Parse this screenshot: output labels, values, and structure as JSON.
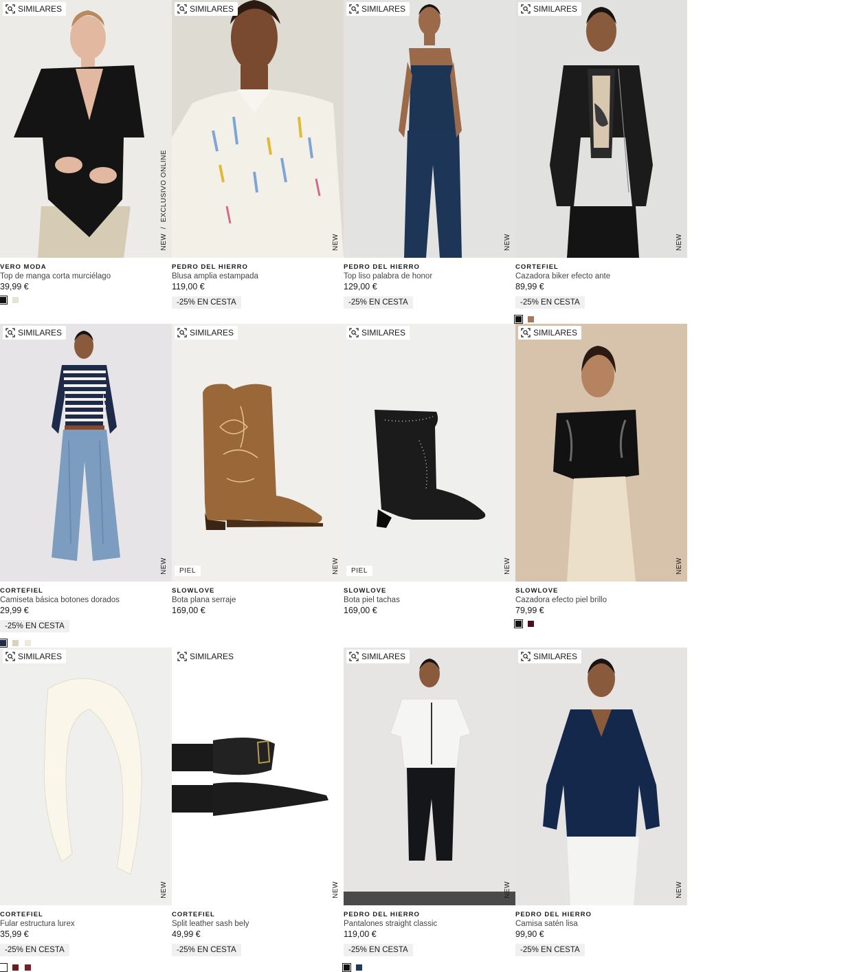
{
  "ui": {
    "similar_label": "SIMILARES",
    "new_label": "NEW",
    "exclusive_label": "EXCLUSIVO ONLINE",
    "promo_label": "-25% EN CESTA"
  },
  "products": [
    {
      "brand": "VERO MODA",
      "name": "Top de manga corta murciélago",
      "price": "39,99 €",
      "promo": "",
      "exclusive": "EXCLUSIVO ONLINE",
      "material": "",
      "swatches": [
        "#111111",
        "#e8e2d5"
      ]
    },
    {
      "brand": "PEDRO DEL HIERRO",
      "name": "Blusa amplia estampada",
      "price": "119,00 €",
      "promo": "-25% EN CESTA",
      "exclusive": "",
      "material": "",
      "swatches": []
    },
    {
      "brand": "PEDRO DEL HIERRO",
      "name": "Top liso palabra de honor",
      "price": "129,00 €",
      "promo": "-25% EN CESTA",
      "exclusive": "",
      "material": "",
      "swatches": []
    },
    {
      "brand": "CORTEFIEL",
      "name": "Cazadora biker efecto ante",
      "price": "89,99 €",
      "promo": "-25% EN CESTA",
      "exclusive": "",
      "material": "",
      "swatches": [
        "#111111",
        "#a47a5f"
      ]
    },
    {
      "brand": "CORTEFIEL",
      "name": "Camiseta básica botones dorados",
      "price": "29,99 €",
      "promo": "-25% EN CESTA",
      "exclusive": "",
      "material": "",
      "swatches": [
        "#1e2a4a",
        "#d9d2bf",
        "#efe9dc"
      ]
    },
    {
      "brand": "SLOWLOVE",
      "name": "Bota plana serraje",
      "price": "169,00 €",
      "promo": "",
      "exclusive": "",
      "material": "PIEL",
      "swatches": []
    },
    {
      "brand": "SLOWLOVE",
      "name": "Bota piel tachas",
      "price": "169,00 €",
      "promo": "",
      "exclusive": "",
      "material": "PIEL",
      "swatches": []
    },
    {
      "brand": "SLOWLOVE",
      "name": "Cazadora efecto piel brillo",
      "price": "79,99 €",
      "promo": "",
      "exclusive": "",
      "material": "",
      "swatches": [
        "#111111",
        "#4a1020"
      ]
    },
    {
      "brand": "CORTEFIEL",
      "name": "Fular estructura lurex",
      "price": "35,99 €",
      "promo": "-25% EN CESTA",
      "exclusive": "",
      "material": "",
      "swatches": [
        "#ffffff",
        "#6b1a24",
        "#7a1e2c"
      ]
    },
    {
      "brand": "CORTEFIEL",
      "name": "Split leather sash bely",
      "price": "49,99 €",
      "promo": "-25% EN CESTA",
      "exclusive": "",
      "material": "",
      "swatches": []
    },
    {
      "brand": "PEDRO DEL HIERRO",
      "name": "Pantalones straight classic",
      "price": "119,00 €",
      "promo": "-25% EN CESTA",
      "exclusive": "",
      "material": "",
      "swatches": [
        "#111111",
        "#1d3a5a"
      ]
    },
    {
      "brand": "PEDRO DEL HIERRO",
      "name": "Camisa satén lisa",
      "price": "99,90 €",
      "promo": "-25% EN CESTA",
      "exclusive": "",
      "material": "",
      "swatches": []
    }
  ]
}
